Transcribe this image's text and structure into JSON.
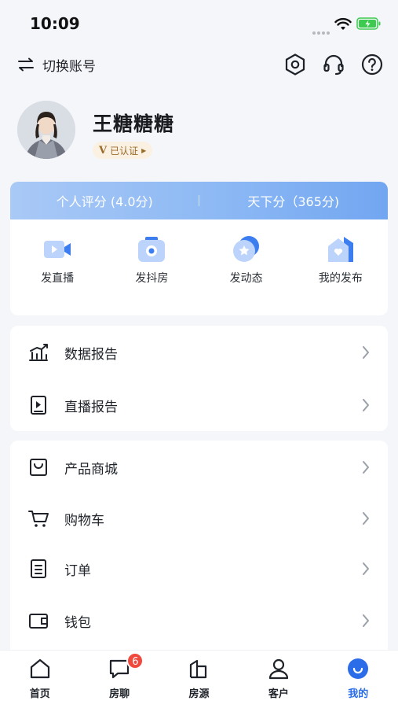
{
  "status_bar": {
    "time": "10:09"
  },
  "topbar": {
    "switch_account_label": "切换账号",
    "icons": [
      "settings-icon",
      "headset-icon",
      "help-icon"
    ]
  },
  "profile": {
    "name": "王糖糖糖",
    "verified_label": "已认证",
    "verified_mark": "V"
  },
  "score": {
    "personal": "个人评分 (4.0分)",
    "world": "天下分（365分)"
  },
  "actions": [
    {
      "label": "发直播",
      "icon": "live-video-icon"
    },
    {
      "label": "发抖房",
      "icon": "camera-icon"
    },
    {
      "label": "发动态",
      "icon": "star-bubble-icon"
    },
    {
      "label": "我的发布",
      "icon": "house-heart-icon"
    }
  ],
  "reports": [
    {
      "label": "数据报告",
      "icon": "chart-icon"
    },
    {
      "label": "直播报告",
      "icon": "play-doc-icon"
    }
  ],
  "shop": [
    {
      "label": "产品商城",
      "icon": "shopping-bag-icon"
    },
    {
      "label": "购物车",
      "icon": "cart-icon"
    },
    {
      "label": "订单",
      "icon": "order-icon"
    },
    {
      "label": "钱包",
      "icon": "wallet-icon"
    }
  ],
  "tabs": [
    {
      "label": "首页",
      "icon": "home-icon"
    },
    {
      "label": "房聊",
      "icon": "chat-icon",
      "badge": "6"
    },
    {
      "label": "房源",
      "icon": "building-icon"
    },
    {
      "label": "客户",
      "icon": "person-icon"
    },
    {
      "label": "我的",
      "icon": "me-icon",
      "active": true
    }
  ],
  "colors": {
    "accent": "#2b6de8",
    "score_bar_start": "#a9c9f6",
    "score_bar_end": "#72a6f1",
    "badge": "#f04a3e",
    "battery": "#3ccb4e"
  }
}
